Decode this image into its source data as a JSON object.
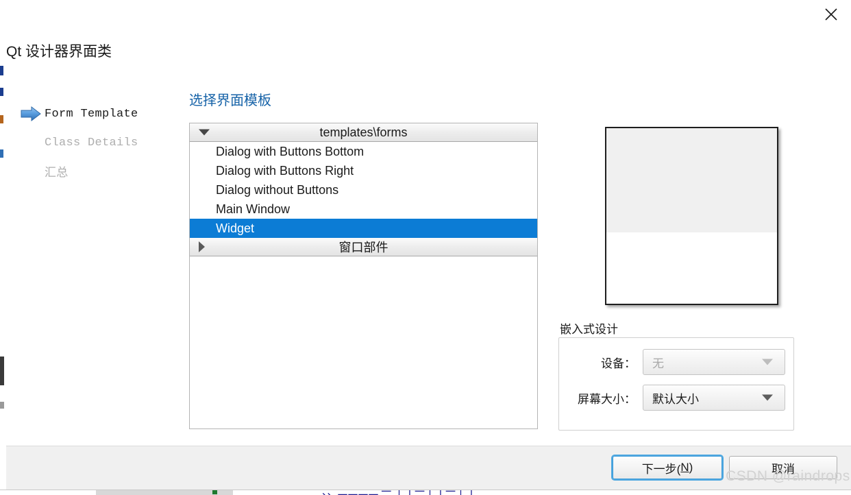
{
  "dialog": {
    "title": "Qt 设计器界面类",
    "close_icon": "close-icon"
  },
  "steps": [
    {
      "label": "Form Template",
      "state": "active",
      "icon": "blue-arrow-icon"
    },
    {
      "label": "Class Details",
      "state": "inactive",
      "icon": ""
    },
    {
      "label": "汇总",
      "state": "inactive",
      "icon": ""
    }
  ],
  "template_section": {
    "heading": "选择界面模板",
    "groups": [
      {
        "name": "templates\\forms",
        "expanded": true,
        "arrow_icon": "chevron-down-icon",
        "items": [
          {
            "label": "Dialog with Buttons Bottom",
            "selected": false
          },
          {
            "label": "Dialog with Buttons Right",
            "selected": false
          },
          {
            "label": "Dialog without Buttons",
            "selected": false
          },
          {
            "label": "Main Window",
            "selected": false
          },
          {
            "label": "Widget",
            "selected": true
          }
        ]
      },
      {
        "name": "窗口部件",
        "expanded": false,
        "arrow_icon": "chevron-right-icon",
        "items": []
      }
    ]
  },
  "preview": {
    "name": "template-preview"
  },
  "embedded": {
    "group_label": "嵌入式设计",
    "fields": [
      {
        "label": "设备：",
        "value": "无",
        "disabled": true,
        "arrow_icon": "chevron-down-icon"
      },
      {
        "label": "屏幕大小：",
        "value": "默认大小",
        "disabled": false,
        "arrow_icon": "chevron-down-icon"
      }
    ]
  },
  "footer": {
    "next_label": "下一步(",
    "next_accel": "N",
    "next_label_end": ")",
    "cancel_label": "取消"
  },
  "watermark": {
    "text": "CSDN @raindrops."
  },
  "background": {
    "bottom_text": "、、二二二二 一 丨丁一丨丁一丨丁"
  },
  "colors": {
    "selection_blue": "#0c7cd5",
    "heading_blue": "#1763a8",
    "focus_blue": "#4fa8e0",
    "footer_gray": "#f0f0f0",
    "inactive_step": "#aeaeae"
  }
}
